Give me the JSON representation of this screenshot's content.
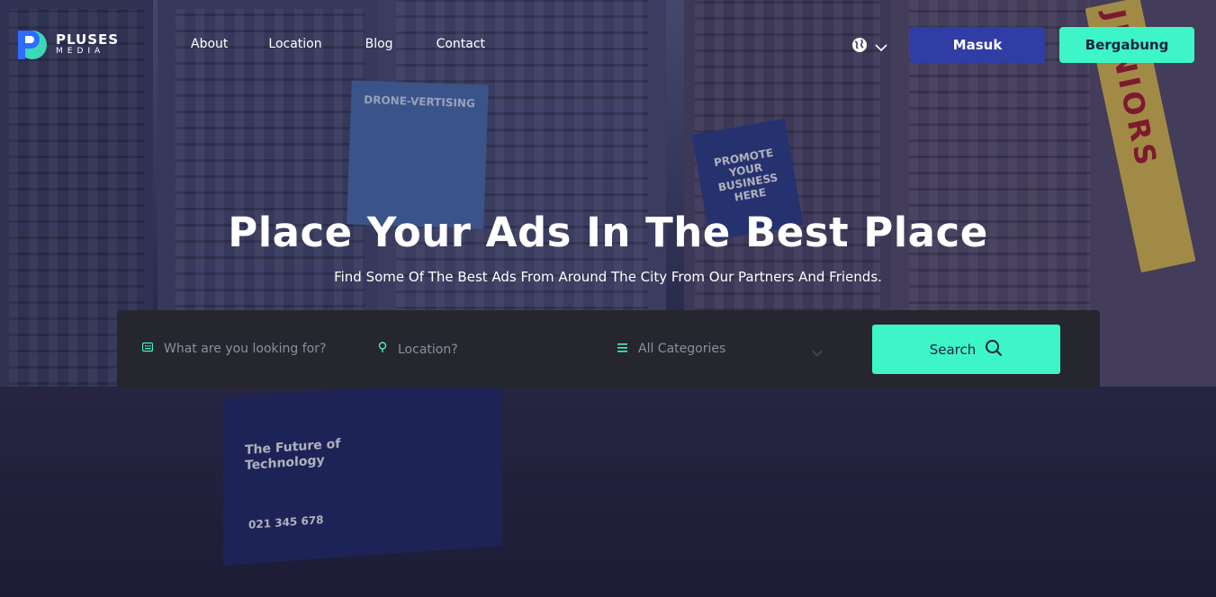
{
  "brand": {
    "name_line1": "PLUSES",
    "name_line2": "MEDIA",
    "accent": "#3ef5c8",
    "primary": "#2f3da4"
  },
  "nav": {
    "items": [
      {
        "label": "About"
      },
      {
        "label": "Location"
      },
      {
        "label": "Blog"
      },
      {
        "label": "Contact"
      }
    ]
  },
  "header": {
    "language_icon": "globe-icon",
    "login_label": "Masuk",
    "join_label": "Bergabung"
  },
  "hero": {
    "title": "Place Your Ads In The Best Place",
    "subtitle": "Find Some Of The Best Ads From Around The City From Our Partners And Friends."
  },
  "search": {
    "keyword_placeholder": "What are you looking for?",
    "location_placeholder": "Location?",
    "category_value": "All Categories",
    "button_label": "Search"
  },
  "background_text": {
    "drone": "DRONE-VERTISING",
    "promote": [
      "PROMOTE",
      "YOUR",
      "BUSINESS",
      "HERE"
    ],
    "future": [
      "The Future of",
      "Technology"
    ],
    "phone": "021 345 678",
    "juniors": "JUNIORS"
  }
}
